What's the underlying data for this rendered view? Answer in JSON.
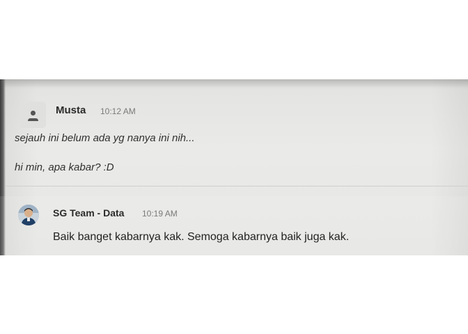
{
  "messages": [
    {
      "author": "Musta",
      "time": "10:12 AM",
      "avatar": "default-user-icon",
      "lines": [
        "sejauh ini belum ada yg nanya ini nih...",
        "hi min, apa kabar? :D"
      ]
    },
    {
      "author": "SG Team - Data",
      "time": "10:19 AM",
      "avatar": "user-photo-avatar",
      "lines": [
        "Baik banget kabarnya kak. Semoga kabarnya baik juga kak."
      ]
    }
  ],
  "colors": {
    "background": "#e8e8e6",
    "name_text": "#2b2b2b",
    "time_text": "#7a7a7a",
    "message_text": "#303030"
  }
}
